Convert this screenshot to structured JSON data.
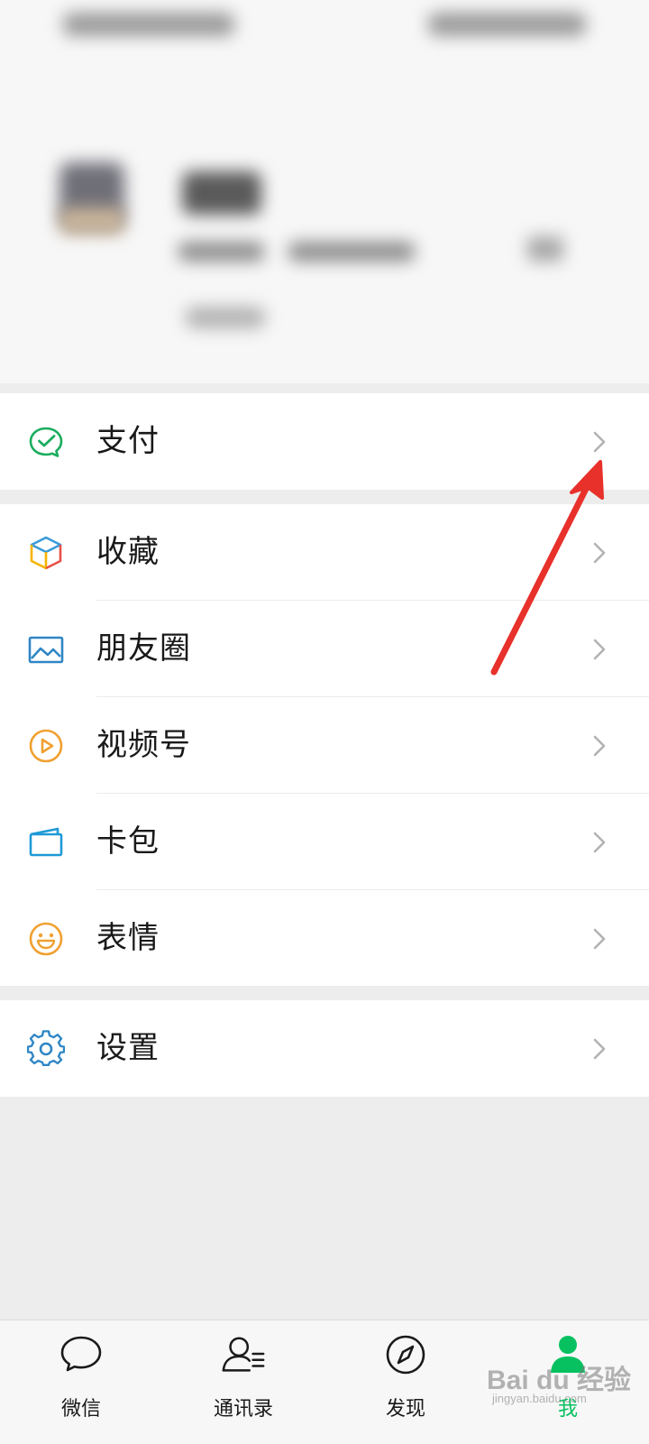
{
  "menu": {
    "payment": {
      "label": "支付",
      "icon": "wechat-pay-icon"
    },
    "group2": [
      {
        "label": "收藏",
        "icon": "favorites-cube-icon"
      },
      {
        "label": "朋友圈",
        "icon": "moments-image-icon"
      },
      {
        "label": "视频号",
        "icon": "channels-play-icon"
      },
      {
        "label": "卡包",
        "icon": "card-wallet-icon"
      },
      {
        "label": "表情",
        "icon": "sticker-smiley-icon"
      }
    ],
    "settings": {
      "label": "设置",
      "icon": "gear-icon"
    }
  },
  "tabbar": {
    "tabs": [
      {
        "label": "微信",
        "icon": "chat-bubble-icon"
      },
      {
        "label": "通讯录",
        "icon": "contacts-icon"
      },
      {
        "label": "发现",
        "icon": "compass-icon"
      },
      {
        "label": "我",
        "icon": "person-icon",
        "active": true
      }
    ]
  },
  "colors": {
    "accent": "#07c160",
    "annotation_arrow": "#e8312b",
    "background": "#ededed"
  },
  "watermark": {
    "brand": "Bai du 经验",
    "url": "jingyan.baidu.com"
  }
}
